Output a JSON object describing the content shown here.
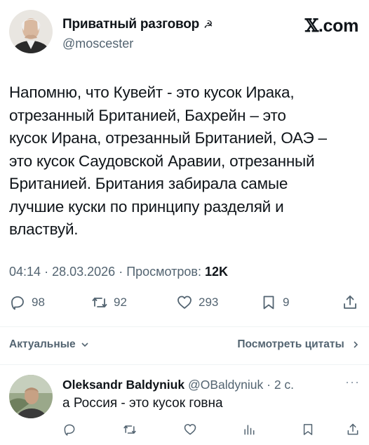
{
  "author": {
    "name": "Приватный разговор",
    "sickle_glyph": "☭",
    "handle": "@moscester",
    "avatar": "portrait-white-hair-man"
  },
  "source": {
    "x_glyph": "𝕏",
    "label": ".com"
  },
  "tweet": {
    "lines": [
      "Напомню, что Кувейт - это кусок Ирака,",
      "отрезанный Британией, Бахрейн – это",
      "кусок Ирана, отрезанный Британией, ОАЭ –",
      "это кусок Саудовской Аравии, отрезанный",
      "Британией. Британия забирала самые",
      "лучшие куски по принципу разделяй и",
      "властвуй."
    ],
    "time": "04:14",
    "date": "28.03.2026",
    "views_label": "Просмотров:",
    "views": "12K",
    "separator": "·"
  },
  "actions": {
    "replies": "98",
    "retweets": "92",
    "likes": "293",
    "bookmarks": "9"
  },
  "sort": {
    "left_label": "Актуальные",
    "right_label": "Посмотреть цитаты"
  },
  "reply": {
    "name": "Oleksandr Baldyniuk",
    "handle": "@OBaldyniuk",
    "time": "2 с.",
    "separator": "·",
    "more": "···",
    "text": "а Россия - это кусок говна"
  },
  "colors": {
    "text": "#0f1419",
    "secondary": "#536471",
    "divider": "#eff3f4"
  }
}
